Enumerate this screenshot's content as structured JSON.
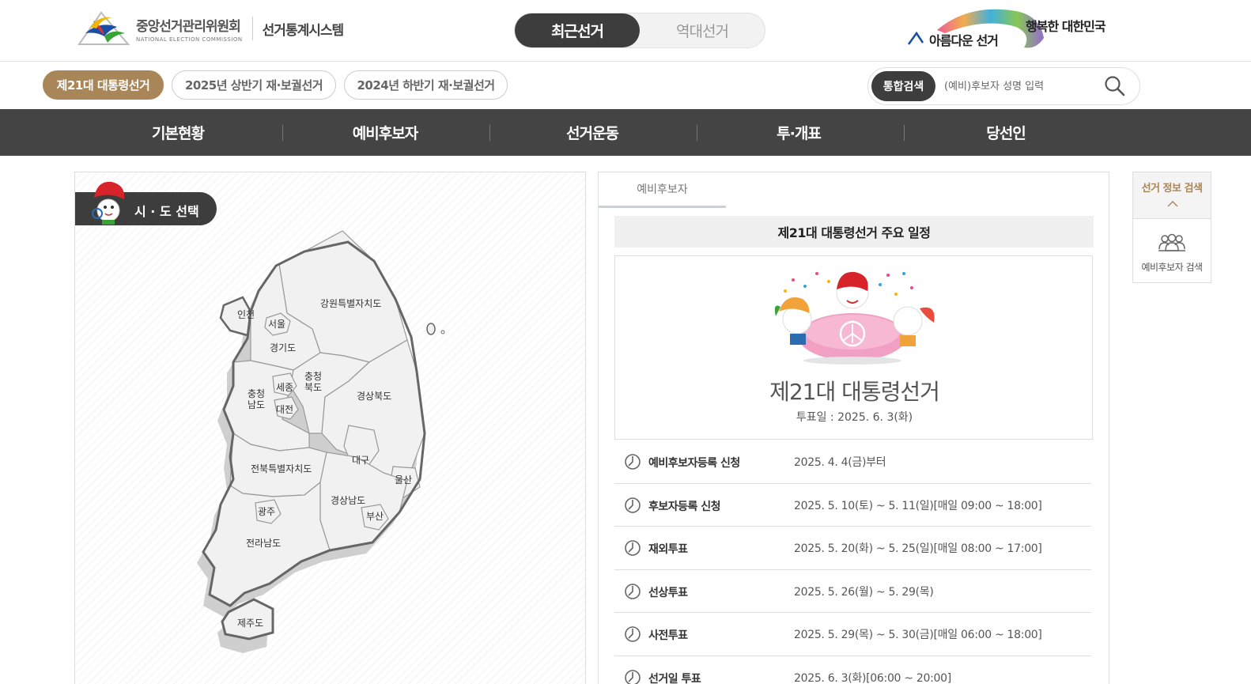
{
  "header": {
    "org_name_kr": "중앙선거관리위원회",
    "org_name_en": "NATIONAL ELECTION COMMISSION",
    "system_title": "선거통계시스템",
    "toggle": {
      "recent": "최근선거",
      "past": "역대선거"
    },
    "slogan_left": "아름다운 선거",
    "slogan_right": "행복한 대한민국"
  },
  "election_tabs": [
    {
      "label": "제21대 대통령선거",
      "active": true
    },
    {
      "label": "2025년 상반기 재·보궐선거",
      "active": false
    },
    {
      "label": "2024년 하반기 재·보궐선거",
      "active": false
    }
  ],
  "search": {
    "label": "통합검색",
    "placeholder": "(예비)후보자 성명 입력"
  },
  "nav": [
    "기본현황",
    "예비후보자",
    "선거운동",
    "투·개표",
    "당선인"
  ],
  "map": {
    "tab_label": "시 · 도 선택",
    "regions": {
      "incheon": "인천",
      "seoul": "서울",
      "gyeonggi": "경기도",
      "gangwon": "강원특별자치도",
      "chungbuk_1": "충청",
      "chungbuk_2": "북도",
      "chungnam_1": "충청",
      "chungnam_2": "남도",
      "sejong": "세종",
      "daejeon": "대전",
      "gyeongbuk": "경상북도",
      "daegu": "대구",
      "ulsan": "울산",
      "jeonbuk": "전북특별자치도",
      "gyeongnam": "경상남도",
      "busan": "부산",
      "gwangju": "광주",
      "jeonnam": "전라남도",
      "jeju": "제주도"
    }
  },
  "info": {
    "tab": "예비후보자",
    "schedule_title": "제21대 대통령선거 주요 일정",
    "hero_title": "제21대 대통령선거",
    "hero_date": "투표일 : 2025. 6. 3(화)",
    "schedule": [
      {
        "label": "예비후보자등록 신청",
        "value": "2025. 4. 4(금)부터"
      },
      {
        "label": "후보자등록 신청",
        "value": "2025. 5. 10(토) ~ 5. 11(일)[매일 09:00 ~ 18:00]"
      },
      {
        "label": "재외투표",
        "value": "2025. 5. 20(화) ~ 5. 25(일)[매일 08:00 ~ 17:00]"
      },
      {
        "label": "선상투표",
        "value": "2025. 5. 26(월) ~ 5. 29(목)"
      },
      {
        "label": "사전투표",
        "value": "2025. 5. 29(목) ~ 5. 30(금)[매일 06:00 ~ 18:00]"
      },
      {
        "label": "선거일 투표",
        "value": "2025. 6. 3(화)[06:00 ~ 20:00]"
      }
    ]
  },
  "quick_menu": {
    "title": "선거 정보 검색",
    "item_label": "예비후보자 검색"
  },
  "colors": {
    "accent_gold": "#a88657",
    "dark": "#3d3d3d",
    "nav_bg": "#444444"
  }
}
